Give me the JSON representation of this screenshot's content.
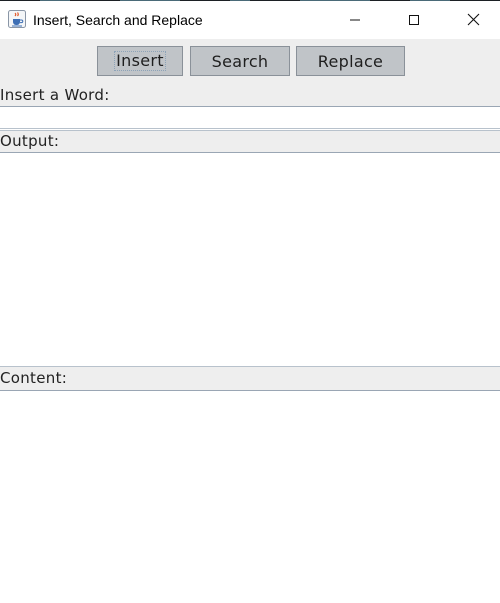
{
  "window": {
    "title": "Insert, Search and Replace",
    "icon": "java-cup-icon",
    "controls": {
      "minimize": "minimize-icon",
      "maximize": "maximize-icon",
      "close": "close-icon"
    }
  },
  "buttons": {
    "insert_label": "Insert",
    "search_label": "Search",
    "replace_label": "Replace"
  },
  "input_section": {
    "label": "Insert a Word:",
    "value": "",
    "placeholder": ""
  },
  "output_section": {
    "label": "Output:",
    "text": ""
  },
  "content_section": {
    "label": "Content:",
    "text": ""
  },
  "colors": {
    "panel_background": "#eeeeee",
    "button_background": "#c0c4c8",
    "separator": "#9aa6b4"
  }
}
